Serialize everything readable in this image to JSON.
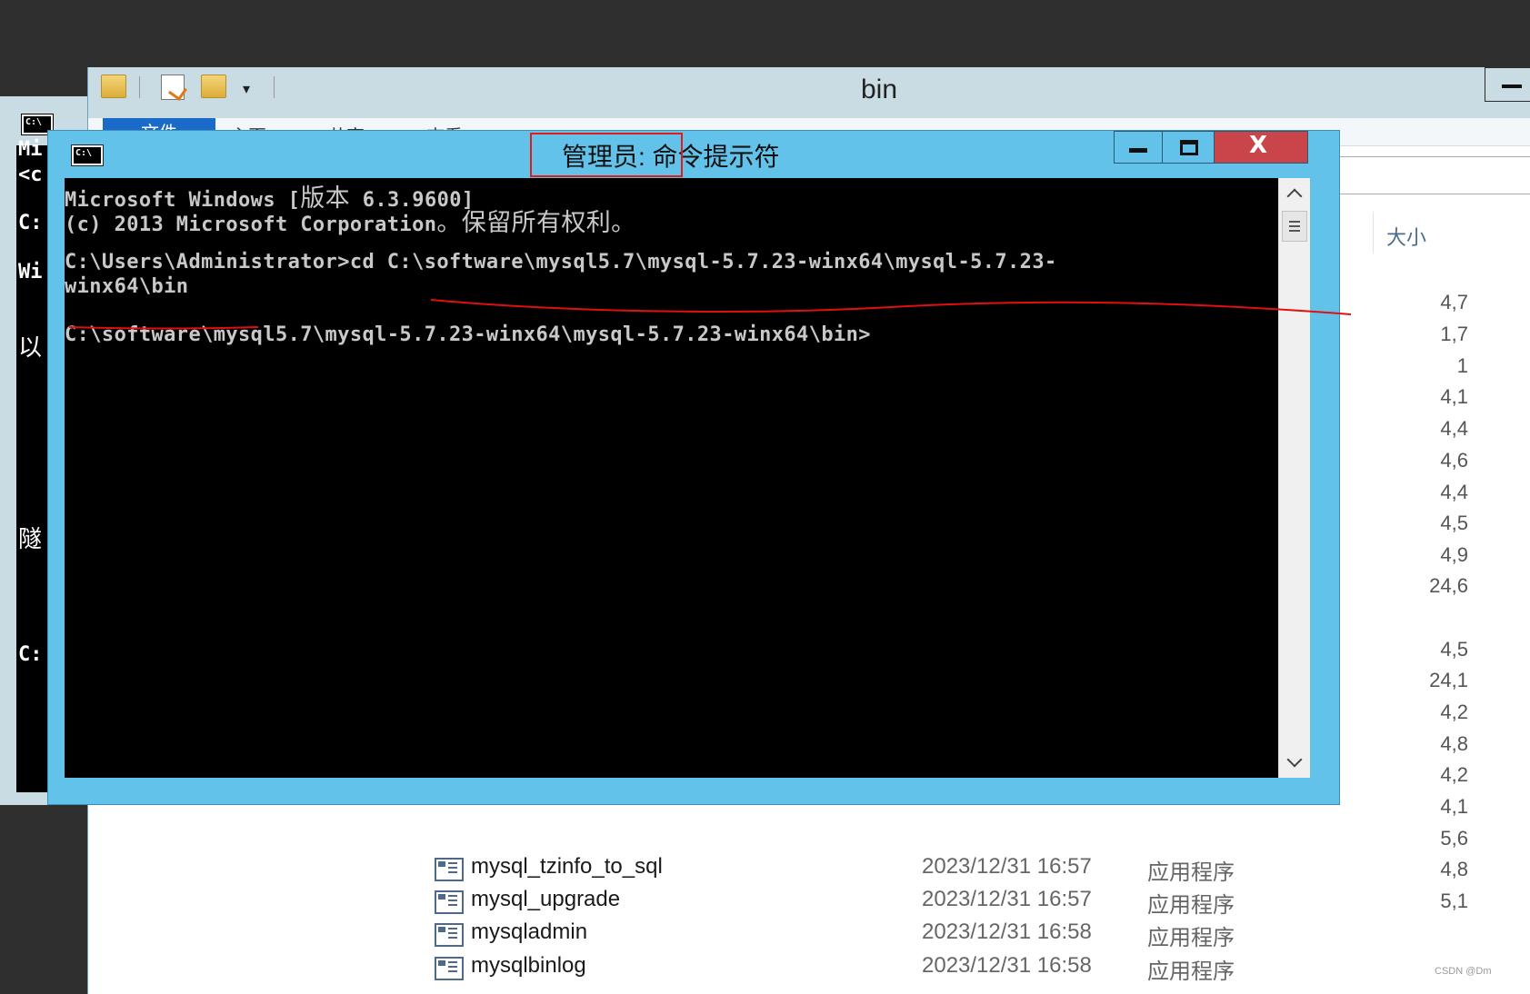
{
  "background_cmd": {
    "icon_label": "C:\\",
    "lines": [
      "Mi",
      "<c",
      "C:",
      "Wi",
      "以",
      "隧",
      "C:"
    ]
  },
  "explorer": {
    "title": "bin",
    "ribbon_tabs": [
      "文件",
      "主页",
      "共享",
      "查看"
    ],
    "size_column_header": "大小",
    "size_values": [
      "4,7",
      "1,7",
      "1",
      "4,1",
      "4,4",
      "4,6",
      "4,4",
      "4,5",
      "4,9",
      "24,6",
      "4,5",
      "24,1",
      "4,2",
      "4,8",
      "4,2",
      "4,1",
      "5,6",
      "4,8",
      "5,1"
    ],
    "files": [
      {
        "name": "mysql_tzinfo_to_sql",
        "date": "2023/12/31 16:57",
        "type": "应用程序"
      },
      {
        "name": "mysql_upgrade",
        "date": "2023/12/31 16:57",
        "type": "应用程序"
      },
      {
        "name": "mysqladmin",
        "date": "2023/12/31 16:58",
        "type": "应用程序"
      },
      {
        "name": "mysqlbinlog",
        "date": "2023/12/31 16:58",
        "type": "应用程序"
      }
    ]
  },
  "cmd": {
    "icon_label": "C:\\",
    "title": "管理员: 命令提示符",
    "close_label": "X",
    "console": {
      "line1_en": "Microsoft Windows [",
      "line1_cn": "版本",
      "line1_tail": " 6.3.9600]",
      "line2_en": "(c) 2013 Microsoft Corporation",
      "line2_cn": "。保留所有权利。",
      "line3": "C:\\Users\\Administrator>cd C:\\software\\mysql5.7\\mysql-5.7.23-winx64\\mysql-5.7.23-",
      "line4": "winx64\\bin",
      "line5": "C:\\software\\mysql5.7\\mysql-5.7.23-winx64\\mysql-5.7.23-winx64\\bin>"
    }
  },
  "watermark": "CSDN @Dm"
}
